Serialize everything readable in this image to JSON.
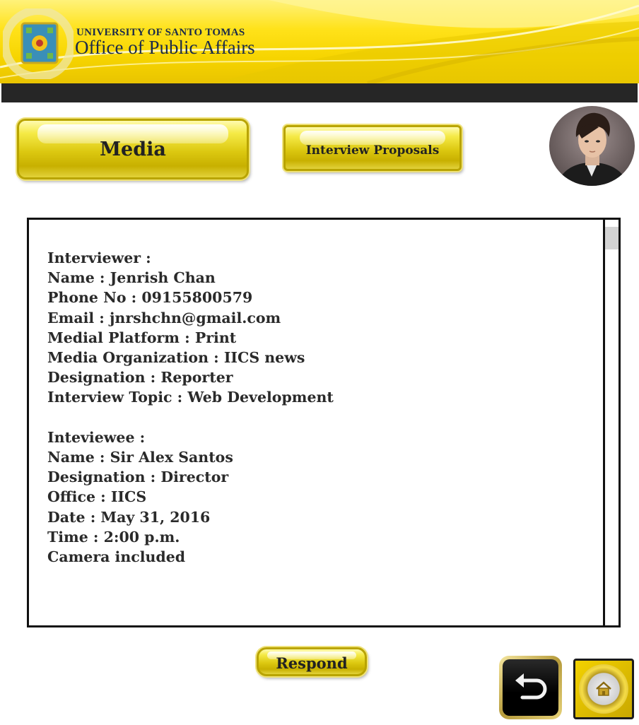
{
  "header": {
    "university": "UNIVERSITY OF SANTO TOMAS",
    "office": "Office of Public Affairs"
  },
  "nav": {
    "media_label": "Media",
    "proposals_label": "Interview Proposals"
  },
  "profile": {
    "avatar_icon": "user-avatar"
  },
  "proposal": {
    "interviewer_heading": "Interviewer :",
    "interviewer_name": "Name : Jenrish Chan",
    "interviewer_phone": "Phone No : 09155800579",
    "interviewer_email": "Email : jnrshchn@gmail.com",
    "interviewer_platform": "Medial Platform : Print",
    "interviewer_org": "Media Organization : IICS news",
    "interviewer_designation": "Designation : Reporter",
    "interview_topic": "Interview Topic : Web Development",
    "interviewee_heading": "Inteviewee :",
    "interviewee_name": "Name : Sir Alex Santos",
    "interviewee_designation": "Designation : Director",
    "interviewee_office": "Office : IICS",
    "interview_date": "Date : May 31, 2016",
    "interview_time": "Time : 2:00 p.m.",
    "camera_note": "Camera included"
  },
  "actions": {
    "respond_label": "Respond",
    "back_icon": "back-arrow-icon",
    "home_icon": "home-icon"
  },
  "colors": {
    "banner_yellow": "#f6d400",
    "nav_bar": "#262626",
    "button_gold": "#dcc810",
    "text_dark": "#2a2a2a"
  }
}
